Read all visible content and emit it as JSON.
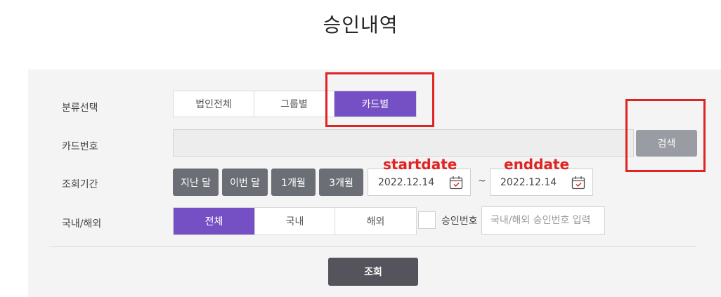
{
  "title": "승인내역",
  "labels": {
    "category": "분류선택",
    "card_number": "카드번호",
    "period": "조회기간",
    "region": "국내/해외"
  },
  "category_tabs": [
    {
      "label": "법인전체",
      "active": false
    },
    {
      "label": "그룹별",
      "active": false
    },
    {
      "label": "카드별",
      "active": true
    }
  ],
  "card_number": {
    "value": "",
    "placeholder": ""
  },
  "search_label": "검색",
  "period_buttons": [
    "지난 달",
    "이번 달",
    "1개월",
    "3개월"
  ],
  "start_date": "2022.12.14",
  "end_date": "2022.12.14",
  "date_separator": "~",
  "region_tabs": [
    {
      "label": "전체",
      "active": true
    },
    {
      "label": "국내",
      "active": false
    },
    {
      "label": "해외",
      "active": false
    }
  ],
  "approval": {
    "checkbox_label": "승인번호",
    "checked": false,
    "placeholder": "국내/해외 승인번호 입력"
  },
  "query_label": "조회",
  "annotations": {
    "startdate": "startdate",
    "enddate": "enddate",
    "color": "#e02424"
  },
  "colors": {
    "accent": "#7550c4",
    "period_button": "#6b6e75",
    "search_button": "#999ca3",
    "query_button": "#55535c"
  },
  "icons": [
    "calendar-icon"
  ]
}
